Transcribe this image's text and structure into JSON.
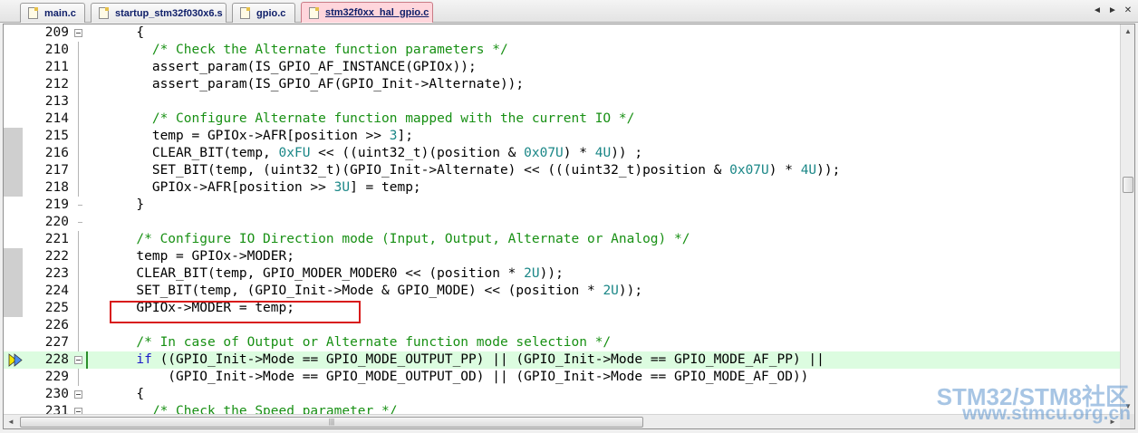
{
  "tabs": [
    {
      "label": "main.c",
      "active": false
    },
    {
      "label": "startup_stm32f030x6.s",
      "active": false
    },
    {
      "label": "gpio.c",
      "active": false
    },
    {
      "label": "stm32f0xx_hal_gpio.c",
      "active": true
    }
  ],
  "tab_controls": {
    "scroll_left": "◄",
    "scroll_right": "►",
    "close": "✕"
  },
  "lines": [
    {
      "num": "209",
      "fold": "open",
      "tokens": [
        [
          "t",
          "      {"
        ]
      ]
    },
    {
      "num": "210",
      "tokens": [
        [
          "c",
          "        /* Check the Alternate function parameters */"
        ]
      ]
    },
    {
      "num": "211",
      "tokens": [
        [
          "t",
          "        assert_param(IS_GPIO_AF_INSTANCE(GPIOx));"
        ]
      ]
    },
    {
      "num": "212",
      "tokens": [
        [
          "t",
          "        assert_param(IS_GPIO_AF(GPIO_Init->Alternate));"
        ]
      ]
    },
    {
      "num": "213",
      "tokens": [
        [
          "t",
          ""
        ]
      ]
    },
    {
      "num": "214",
      "tokens": [
        [
          "c",
          "        /* Configure Alternate function mapped with the current IO */"
        ]
      ]
    },
    {
      "num": "215",
      "tokens": [
        [
          "t",
          "        temp = GPIOx->AFR[position >> "
        ],
        [
          "n",
          "3"
        ],
        [
          "t",
          "];"
        ]
      ]
    },
    {
      "num": "216",
      "tokens": [
        [
          "t",
          "        CLEAR_BIT(temp, "
        ],
        [
          "n",
          "0xFU"
        ],
        [
          "t",
          " << ((uint32_t)(position & "
        ],
        [
          "n",
          "0x07U"
        ],
        [
          "t",
          ") * "
        ],
        [
          "n",
          "4U"
        ],
        [
          "t",
          ")) ;"
        ]
      ]
    },
    {
      "num": "217",
      "tokens": [
        [
          "t",
          "        SET_BIT(temp, (uint32_t)(GPIO_Init->Alternate) << (((uint32_t)position & "
        ],
        [
          "n",
          "0x07U"
        ],
        [
          "t",
          ") * "
        ],
        [
          "n",
          "4U"
        ],
        [
          "t",
          "));"
        ]
      ]
    },
    {
      "num": "218",
      "tokens": [
        [
          "t",
          "        GPIOx->AFR[position >> "
        ],
        [
          "n",
          "3U"
        ],
        [
          "t",
          "] = temp;"
        ]
      ]
    },
    {
      "num": "219",
      "fold": "end",
      "tokens": [
        [
          "t",
          "      }"
        ]
      ]
    },
    {
      "num": "220",
      "fold": "end",
      "tokens": [
        [
          "t",
          ""
        ]
      ]
    },
    {
      "num": "221",
      "tokens": [
        [
          "c",
          "      /* Configure IO Direction mode (Input, Output, Alternate or Analog) */"
        ]
      ]
    },
    {
      "num": "222",
      "tokens": [
        [
          "t",
          "      temp = GPIOx->MODER;"
        ]
      ]
    },
    {
      "num": "223",
      "tokens": [
        [
          "t",
          "      CLEAR_BIT(temp, GPIO_MODER_MODER0 << (position * "
        ],
        [
          "n",
          "2U"
        ],
        [
          "t",
          "));"
        ]
      ]
    },
    {
      "num": "224",
      "tokens": [
        [
          "t",
          "      SET_BIT(temp, (GPIO_Init->Mode & GPIO_MODE) << (position * "
        ],
        [
          "n",
          "2U"
        ],
        [
          "t",
          "));"
        ]
      ]
    },
    {
      "num": "225",
      "tokens": [
        [
          "t",
          "      GPIOx->MODER = temp;"
        ]
      ]
    },
    {
      "num": "226",
      "tokens": [
        [
          "t",
          ""
        ]
      ]
    },
    {
      "num": "227",
      "tokens": [
        [
          "c",
          "      /* In case of Output or Alternate function mode selection */"
        ]
      ]
    },
    {
      "num": "228",
      "fold": "open",
      "current": true,
      "exec": true,
      "tokens": [
        [
          "k",
          "      if"
        ],
        [
          "t",
          " ((GPIO_Init->Mode == GPIO_MODE_OUTPUT_PP) || (GPIO_Init->Mode == GPIO_MODE_AF_PP) ||"
        ]
      ]
    },
    {
      "num": "229",
      "tokens": [
        [
          "t",
          "          (GPIO_Init->Mode == GPIO_MODE_OUTPUT_OD) || (GPIO_Init->Mode == GPIO_MODE_AF_OD))"
        ]
      ]
    },
    {
      "num": "230",
      "fold": "open",
      "tokens": [
        [
          "t",
          "      {"
        ]
      ]
    },
    {
      "num": "231",
      "fold": "open",
      "tokens": [
        [
          "c",
          "        /* Check the Speed parameter */"
        ]
      ]
    }
  ],
  "watermark": {
    "line1": "STM32/STM8社区",
    "line2": "www.stmcu.org.cn"
  },
  "colors": {
    "comment": "#189014",
    "number": "#1b8787",
    "keyword": "#1c1cc8",
    "current_line": "#dcfce0",
    "highlight_box": "#d81b1b",
    "active_tab": "#ffd6dc"
  }
}
